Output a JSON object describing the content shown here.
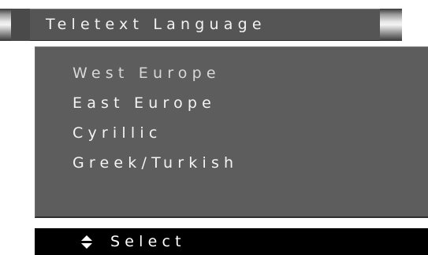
{
  "header": {
    "title": "Teletext Language"
  },
  "menu": {
    "items": [
      {
        "label": "West Europe",
        "selected": true
      },
      {
        "label": "East Europe",
        "selected": false
      },
      {
        "label": "Cyrillic",
        "selected": false
      },
      {
        "label": "Greek/Turkish",
        "selected": false
      }
    ]
  },
  "footer": {
    "icon": "up-down-arrows-icon",
    "label": "Select"
  },
  "colors": {
    "panel": "#5d5d5d",
    "title_panel": "#555555",
    "footer": "#000000",
    "text": "#f4f4f4"
  }
}
